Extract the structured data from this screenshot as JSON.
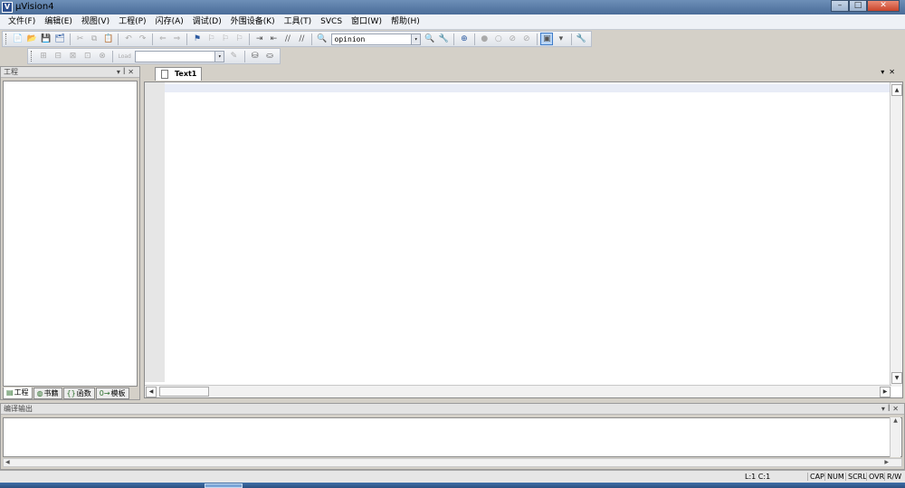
{
  "window": {
    "app_icon": "keil-uv-icon",
    "title": "µVision4",
    "min_label": "–",
    "max_label": "□",
    "close_label": "✕"
  },
  "menu": [
    "文件(F)",
    "编辑(E)",
    "视图(V)",
    "工程(P)",
    "闪存(A)",
    "调试(D)",
    "外围设备(K)",
    "工具(T)",
    "SVCS",
    "窗口(W)",
    "帮助(H)"
  ],
  "toolbar": {
    "target_combo_value": "opinion",
    "combo_arrow": "▾",
    "load_label": "Load",
    "icons": {
      "new": "📄",
      "open": "📂",
      "save": "💾",
      "save_all": "🗂",
      "cut": "✂",
      "copy": "⧉",
      "paste": "📋",
      "undo": "↶",
      "redo": "↷",
      "back": "⇐",
      "forward": "⇒",
      "bookmark": "⚑",
      "prev_bookmark": "⚐",
      "next_bookmark": "⚐",
      "clear_bookmarks": "⚐",
      "indent": "⇥",
      "unindent": "⇤",
      "comment": "//",
      "uncomment": "//",
      "find_files": "🔍",
      "debug": "⊕",
      "breakpoint": "●",
      "breakpoint_disable": "○",
      "breakpoint_kill": "⊘",
      "window_select": "▣",
      "config": "🔧",
      "translate": "⊞",
      "build": "⊟",
      "rebuild": "⊠",
      "batch": "⊡",
      "stop": "⊗",
      "target_options": "✎",
      "manage": "⛁",
      "packs": "⛀"
    }
  },
  "project_panel": {
    "title": "工程",
    "controls": [
      "▾",
      "ꟾ",
      "✕"
    ],
    "tabs": [
      {
        "label": "工程",
        "icon": "▤"
      },
      {
        "label": "书籍",
        "icon": "◍"
      },
      {
        "label": "函数",
        "icon": "{}"
      },
      {
        "label": "模板",
        "icon": "0→"
      }
    ]
  },
  "editor": {
    "tab_label": "Text1",
    "controls": [
      "▾",
      "✕"
    ],
    "scroll": {
      "up": "▲",
      "down": "▼",
      "left": "◀",
      "right": "▶"
    }
  },
  "output_panel": {
    "title": "编译输出",
    "controls": [
      "▾",
      "ꟾ",
      "✕"
    ],
    "scroll": {
      "left": "◀",
      "right": "▶",
      "up": "▲",
      "down": "▼"
    }
  },
  "status": {
    "position": "L:1 C:1",
    "indicators": [
      "CAP",
      "NUM",
      "SCRL",
      "OVR",
      "R/W"
    ]
  }
}
